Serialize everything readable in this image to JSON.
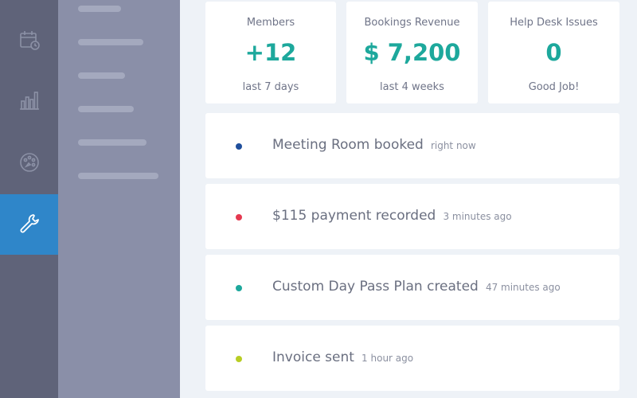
{
  "nav_rail": {
    "items": [
      {
        "icon": "calendar-icon",
        "active": false
      },
      {
        "icon": "bar-chart-icon",
        "active": false
      },
      {
        "icon": "palette-icon",
        "active": false
      },
      {
        "icon": "wrench-icon",
        "active": true
      }
    ]
  },
  "colors": {
    "rail_bg": "#5f6379",
    "subnav_bg": "#8a8fa8",
    "active_item": "#2f86c9",
    "accent_teal": "#1da89c",
    "page_bg": "#eef2f7"
  },
  "stats": [
    {
      "label": "Members",
      "value": "+12",
      "caption": "last 7 days"
    },
    {
      "label": "Bookings Revenue",
      "value": "$ 7,200",
      "caption": "last 4 weeks"
    },
    {
      "label": "Help Desk Issues",
      "value": "0",
      "caption": "Good Job!"
    }
  ],
  "activity": [
    {
      "title": "Meeting Room booked",
      "time": "right now",
      "dot_color": "#1f4f9c"
    },
    {
      "title": "$115 payment recorded",
      "time": "3 minutes ago",
      "dot_color": "#e53950"
    },
    {
      "title": "Custom Day Pass Plan created",
      "time": "47 minutes ago",
      "dot_color": "#1da89c"
    },
    {
      "title": "Invoice sent",
      "time": "1 hour ago",
      "dot_color": "#b8cd24"
    }
  ]
}
